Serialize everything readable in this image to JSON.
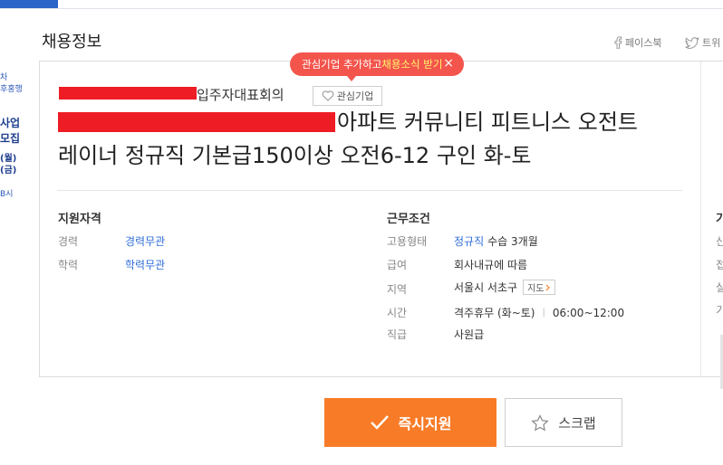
{
  "page": {
    "title": "채용정보"
  },
  "share": {
    "facebook": "페이스북",
    "twitter": "트위"
  },
  "tooltip": {
    "text": "관심기업 추가하고 ",
    "highlight": "채용소식 받기",
    "close": "×"
  },
  "company": {
    "name": "입주자대표회의",
    "favorite_label": "관심기업"
  },
  "job": {
    "title_line1": "아파트 커뮤니티 피트니스 오전트",
    "title_line2": "레이너 정규직 기본급150이상 오전6-12 구인 화-토"
  },
  "qualifications": {
    "heading": "지원자격",
    "rows": [
      {
        "label": "경력",
        "value": "경력무관"
      },
      {
        "label": "학력",
        "value": "학력무관"
      }
    ]
  },
  "conditions": {
    "heading": "근무조건",
    "employment_label": "고용형태",
    "employment_value": "정규직",
    "employment_extra": "수습 3개월",
    "salary_label": "급여",
    "salary_value": "회사내규에 따름",
    "region_label": "지역",
    "region_value": "서울시 서초구",
    "map_label": "지도",
    "time_label": "시간",
    "time_days": "격주휴무 (화~토)",
    "time_sep": "|",
    "time_hours": "06:00~12:00",
    "position_label": "직급",
    "position_value": "사원급"
  },
  "right_column_partial": {
    "heading": "기",
    "items": [
      "신",
      "접",
      "실",
      "기"
    ]
  },
  "left_ad": {
    "lines": [
      "차",
      "후홍행",
      "사업",
      "모집",
      "(월)",
      "(금)",
      "B시"
    ]
  },
  "actions": {
    "apply_label": "즉시지원",
    "scrap_label": "스크랩"
  },
  "colors": {
    "accent_orange": "#f87c27",
    "tooltip_red": "#f3554c",
    "link_blue": "#2f6ed8",
    "redaction": "#ee1c25"
  }
}
